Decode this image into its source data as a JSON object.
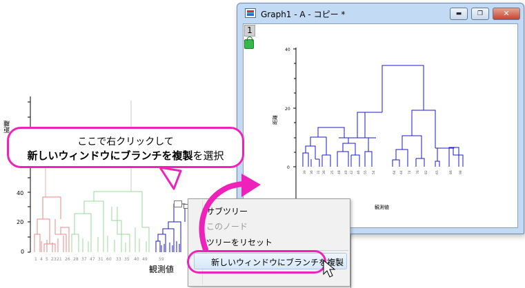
{
  "graph_window": {
    "title": "Graph1 - A - コピー *",
    "minimize_label": "▬",
    "maximize_label": "❐",
    "close_label": "✕",
    "layer_label": "1"
  },
  "graph": {
    "ylabel": "距離",
    "xlabel": "観測値",
    "y_ticks": [
      "40",
      "20",
      "0"
    ],
    "leaf_labels": [
      "39",
      "36",
      "31",
      "36",
      "25",
      "48",
      "49",
      "42",
      "46",
      "55",
      "54",
      "64",
      "44",
      "74",
      "76",
      "82",
      "65",
      "86",
      "98"
    ]
  },
  "background_graph": {
    "ylabel": "距離",
    "xlabel": "観測値",
    "y_ticks": [
      "40",
      "20",
      "0"
    ],
    "leaf_labels": [
      "1",
      "4",
      "5",
      "23",
      "21",
      "26",
      "28",
      "37",
      "47",
      "31",
      "60",
      "33",
      "35",
      "40",
      "49",
      "59"
    ]
  },
  "context_menu": {
    "items": [
      {
        "label": "サブツリー",
        "enabled": true
      },
      {
        "label": "このノード",
        "enabled": false
      },
      {
        "label": "ツリーをリセット",
        "enabled": true
      }
    ],
    "copy_item": "新しいウィンドウにブランチを複製"
  },
  "callout": {
    "line1": "ここで右クリックして",
    "line2_bold": "新しいウィンドウにブランチを複製",
    "line2_rest": "を選択"
  },
  "colors": {
    "accent": "#ee22bb",
    "dendro_blue": "#1a1acc",
    "dendro_red": "#e88a8a",
    "dendro_green": "#9ad89a"
  }
}
